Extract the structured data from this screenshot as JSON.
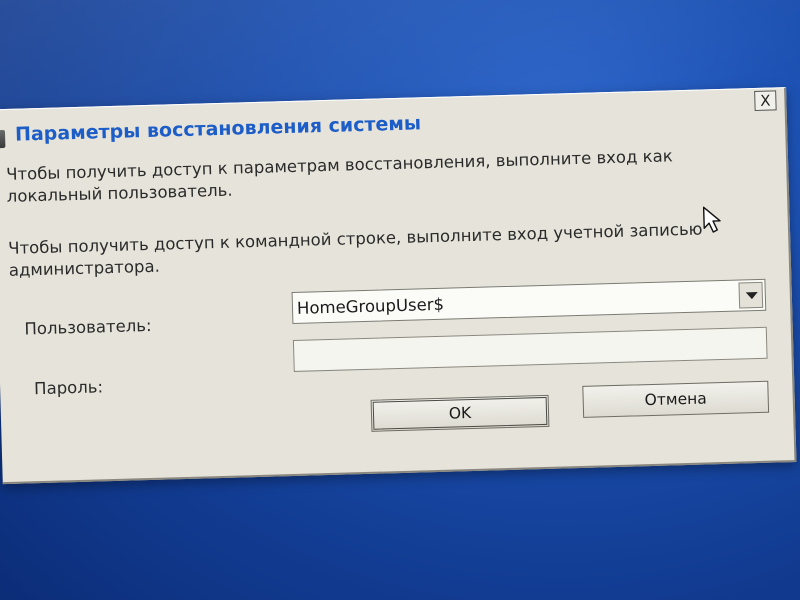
{
  "dialog": {
    "title": "Параметры восстановления системы",
    "close_label": "X",
    "info_line1": "Чтобы получить доступ к параметрам восстановления, выполните вход как локальный пользователь.",
    "info_line2": "Чтобы получить доступ к командной строке, выполните вход учетной записью администратора.",
    "user_label": "Пользователь:",
    "user_value": "HomeGroupUser$",
    "password_label": "Пароль:",
    "password_value": "",
    "ok_label": "OK",
    "cancel_label": "Отмена"
  },
  "colors": {
    "desktop": "#1b4fb0",
    "dialog_bg": "#e6e4da",
    "title_text": "#1d5dc8"
  },
  "icons": [
    "window-icon",
    "close-icon",
    "chevron-down-icon",
    "mouse-cursor-icon"
  ]
}
